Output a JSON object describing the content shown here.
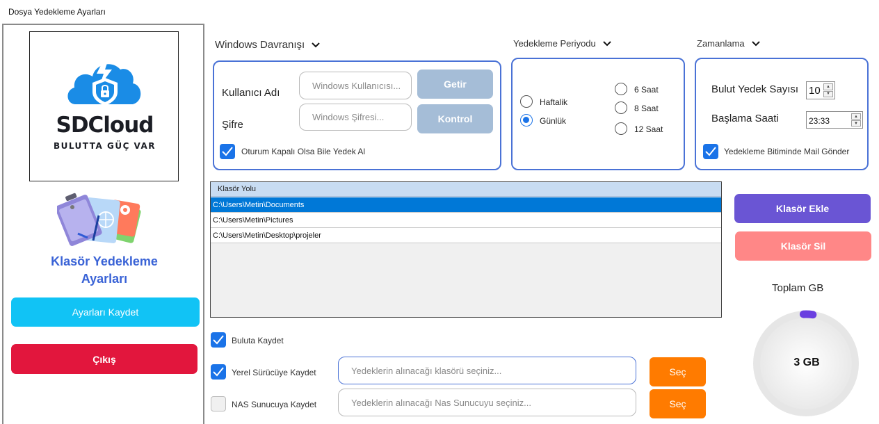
{
  "window": {
    "title": "Dosya Yedekleme Ayarları"
  },
  "brand": {
    "name": "SDCloud",
    "tagline": "BULUTTA GÜÇ VAR"
  },
  "left": {
    "title": "Klasör Yedekleme Ayarları",
    "save_label": "Ayarları Kaydet",
    "exit_label": "Çıkış"
  },
  "windows": {
    "header": "Windows Davranışı",
    "user_label": "Kullanıcı Adı",
    "user_placeholder": "Windows Kullanıcısı...",
    "password_label": "Şifre",
    "password_placeholder": "Windows Şifresi...",
    "fetch_label": "Getir",
    "check_label": "Kontrol",
    "logoff_label": "Oturum Kapalı Olsa Bile Yedek Al",
    "logoff_checked": true
  },
  "period": {
    "header": "Yedekleme Periyodu",
    "options": [
      {
        "label": "Haftalik",
        "selected": false
      },
      {
        "label": "Günlük",
        "selected": true
      },
      {
        "label": "6 Saat",
        "selected": false
      },
      {
        "label": "8 Saat",
        "selected": false
      },
      {
        "label": "12 Saat",
        "selected": false
      }
    ]
  },
  "schedule": {
    "header": "Zamanlama",
    "cloud_count_label": "Bulut Yedek Sayısı",
    "cloud_count_value": "10",
    "start_label": "Başlama Saati",
    "start_value": "23:33",
    "mail_label": "Yedekleme Bitiminde Mail Gönder",
    "mail_checked": true
  },
  "folders": {
    "column_header": "Klasör Yolu",
    "rows": [
      {
        "path": "C:\\Users\\Metin\\Documents",
        "selected": true
      },
      {
        "path": "C:\\Users\\Metin\\Pictures",
        "selected": false
      },
      {
        "path": "C:\\Users\\Metin\\Desktop\\projeler",
        "selected": false
      }
    ],
    "add_label": "Klasör Ekle",
    "remove_label": "Klasör Sil"
  },
  "targets": {
    "cloud_label": "Buluta Kaydet",
    "cloud_checked": true,
    "local_label": "Yerel Sürücüye Kaydet",
    "local_checked": true,
    "local_placeholder": "Yedeklerin alınacağı klasörü seçiniz...",
    "nas_label": "NAS Sunucuya Kaydet",
    "nas_checked": false,
    "nas_placeholder": "Yedeklerin alınacağı Nas Sunucuyu seçiniz...",
    "select_label": "Seç"
  },
  "storage": {
    "title": "Toplam GB",
    "value_label": "3 GB",
    "fraction": 0.03
  },
  "colors": {
    "accent": "#4a72d6",
    "check": "#1a73e8",
    "save": "#11c3f5",
    "exit": "#e2163d",
    "add": "#6a55d4",
    "remove": "#ff8787",
    "select": "#ff7b00",
    "gauge": "#6a3fe0"
  }
}
